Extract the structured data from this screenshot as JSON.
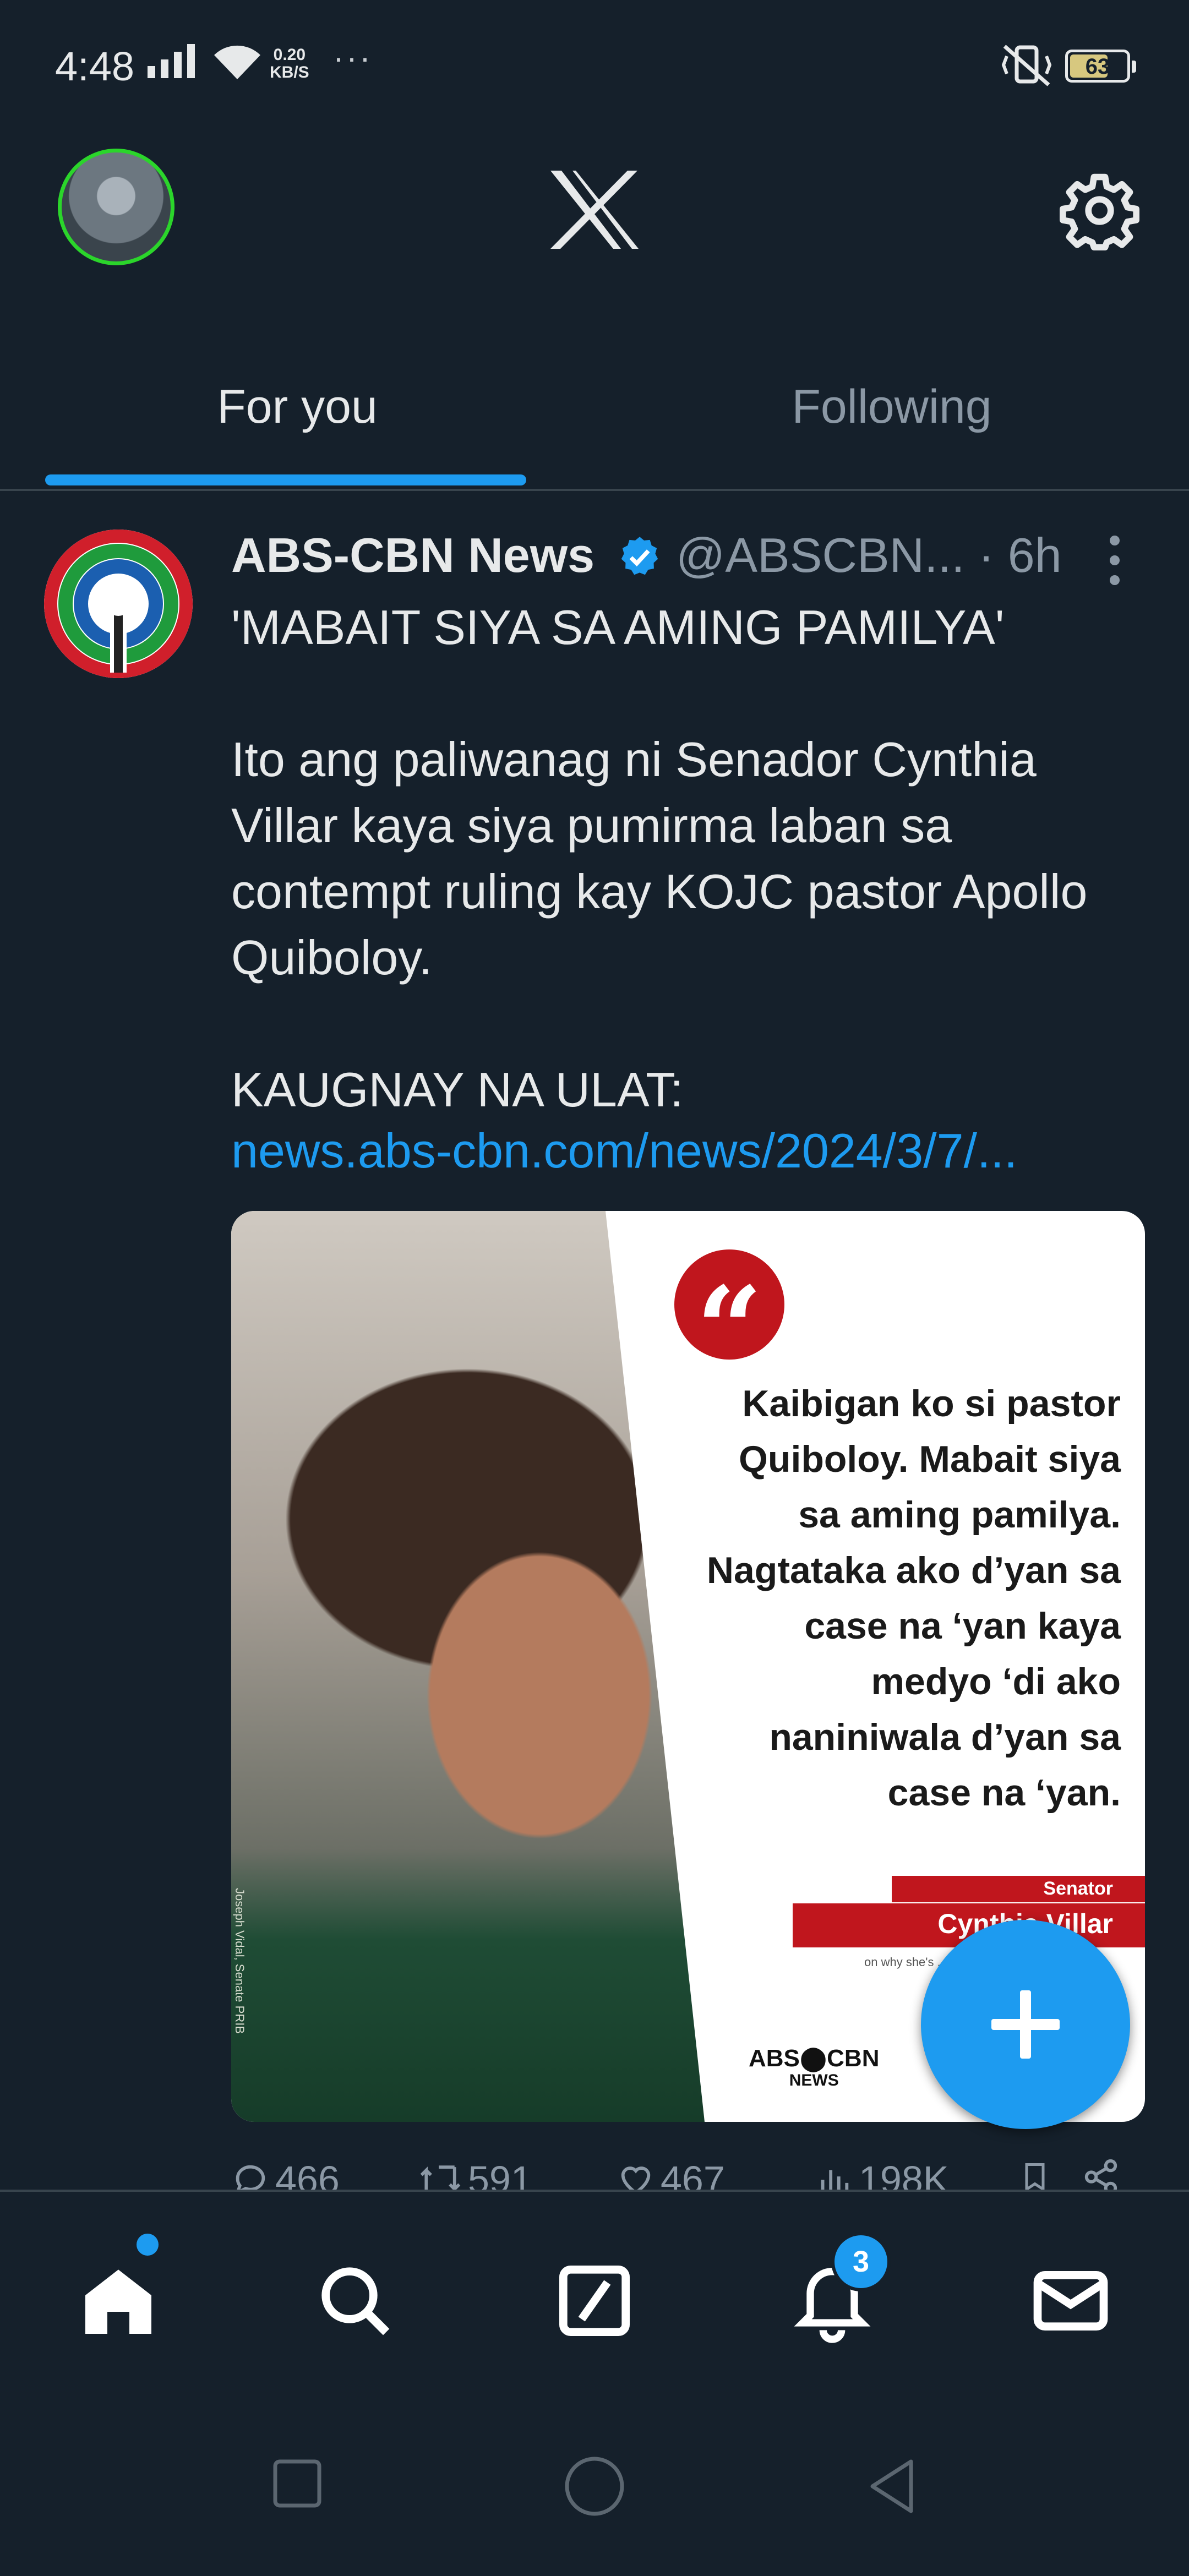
{
  "status_bar": {
    "time": "4:48",
    "net_speed_value": "0.20",
    "net_speed_unit": "KB/S",
    "more": "···",
    "battery": "63"
  },
  "header": {
    "logo_icon": "x-logo-icon",
    "settings_icon": "gear-icon"
  },
  "tabs": [
    {
      "label": "For you",
      "active": true
    },
    {
      "label": "Following",
      "active": false
    }
  ],
  "post": {
    "author": "ABS-CBN News",
    "handle_time": "@ABSCBN... · 6h",
    "text": "'MABAIT SIYA SA AMING PAMILYA'\n\nIto ang paliwanag ni Senador Cynthia\nVillar kaya siya pumirma laban sa\ncontempt ruling kay KOJC pastor Apollo\nQuiboloy.\n\nKAUGNAY NA ULAT:",
    "link": "news.abs-cbn.com/news/2024/3/7/...",
    "media": {
      "quote_mark": "“",
      "quote": "Kaibigan ko si pastor\nQuiboloy. Mabait siya\nsa aming pamilya.\nNagtataka ako d’yan sa\ncase na ‘yan kaya\nmedyo ‘di ako\nnaniniwala d’yan sa\ncase na ‘yan.",
      "speaker_title": "Senator",
      "speaker_name": "Cynthia Villar",
      "sub": "on why she's ... vs A...",
      "brand_top": "ABS⬤CBN",
      "brand_bottom": "NEWS",
      "photo_credit": "Joseph Vidal, Senate PRIB"
    },
    "actions": {
      "replies": "466",
      "reposts": "591",
      "likes": "467",
      "views": "198K"
    }
  },
  "notifications_count": "3",
  "colors": {
    "background": "#15202b",
    "accent": "#1d9bf0",
    "muted": "#8b98a5",
    "brand_red": "#c0161d"
  }
}
